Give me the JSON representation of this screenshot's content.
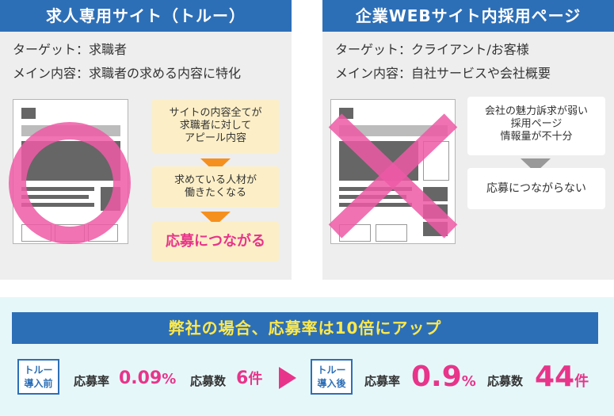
{
  "left_panel": {
    "title": "求人専用サイト（トルー）",
    "target_line": "ターゲット：求職者",
    "content_line": "メイン内容：求職者の求める内容に特化",
    "step1": [
      "サイトの内容全てが",
      "求職者に対して",
      "アピール内容"
    ],
    "step2": [
      "求めている人材が",
      "働きたくなる"
    ],
    "result": "応募につながる",
    "mark_icon": "circle-mark-icon",
    "mark_color": "#ee5aa6"
  },
  "right_panel": {
    "title": "企業WEBサイト内採用ページ",
    "target_line": "ターゲット：クライアント/お客様",
    "content_line": "メイン内容：自社サービスや会社概要",
    "step1": [
      "会社の魅力訴求が弱い",
      "採用ページ",
      "情報量が不十分"
    ],
    "result": "応募につながらない",
    "mark_icon": "cross-mark-icon"
  },
  "summary": {
    "headline": "弊社の場合、応募率は10倍にアップ",
    "before": {
      "badge": [
        "トルー",
        "導入前"
      ],
      "rate_label": "応募率",
      "rate_value": "0.09",
      "rate_unit": "%",
      "count_label": "応募数",
      "count_value": "6",
      "count_unit": "件"
    },
    "arrow_icon": "triangle-right-icon",
    "after": {
      "badge": [
        "トルー",
        "導入後"
      ],
      "rate_label": "応募率",
      "rate_value": "0.9",
      "rate_unit": "%",
      "count_label": "応募数",
      "count_value": "44",
      "count_unit": "件"
    }
  },
  "colors": {
    "brand_blue": "#2d6fb7",
    "accent_pink": "#e8348a",
    "highlight_yellow": "#ffe94a",
    "step_bg": "#fcefc7",
    "arrow_orange": "#f5901e"
  }
}
